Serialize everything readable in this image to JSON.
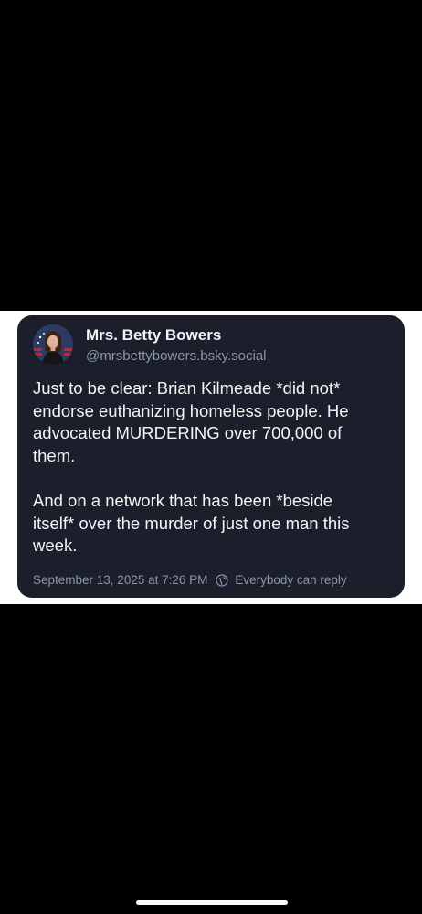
{
  "post": {
    "author": {
      "display_name": "Mrs. Betty Bowers",
      "handle": "@mrsbettybowers.bsky.social"
    },
    "paragraphs": [
      "Just to be clear: Brian Kilmeade *did not*\nendorse euthanizing homeless people. He\nadvocated MURDERING over 700,000 of\nthem.",
      "And on a network that has been *beside\nitself* over the murder of just one man this\nweek."
    ],
    "timestamp": "September 13, 2025 at 7:26 PM",
    "reply_setting": "Everybody can reply"
  },
  "colors": {
    "card_background": "#1b1f2b",
    "text_primary": "#f3f4f6",
    "text_secondary": "#8b95a6",
    "page_background": "#000000",
    "band_background": "#ffffff"
  },
  "icons": {
    "avatar": "profile-photo",
    "reply": "globe-icon"
  }
}
